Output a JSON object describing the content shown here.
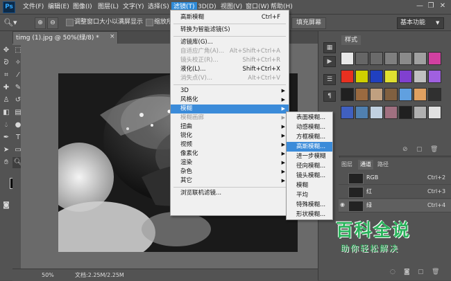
{
  "app": {
    "logo": "Ps"
  },
  "menubar": {
    "items": [
      "文件(F)",
      "编辑(E)",
      "图像(I)",
      "图层(L)",
      "文字(Y)",
      "选择(S)",
      "滤镜(T)",
      "3D(D)",
      "视图(V)",
      "窗口(W)",
      "帮助(H)"
    ],
    "window_buttons": [
      "—",
      "❐",
      "✕"
    ]
  },
  "options_bar": {
    "tool_icon": "zoom-icon",
    "checkbox1_label": "调整窗口大小以满屏显示",
    "checkbox2_label": "缩放所有",
    "fill_screen_button": "填充屏幕",
    "workspace_select": "基本功能"
  },
  "document": {
    "tab_label": "timg (1).jpg @ 50%(绿/8) *",
    "close": "×",
    "zoom": "50%",
    "doc_info": "文档:2.25M/2.25M",
    "image_desc": "rose-photo-channel-grayscale"
  },
  "filter_menu": {
    "items": [
      {
        "label": "高斯模糊",
        "shortcut": "Ctrl+F",
        "disabled": false
      },
      {
        "sep": true
      },
      {
        "label": "转换为智能滤镜(S)",
        "disabled": false
      },
      {
        "sep": true
      },
      {
        "label": "滤镜库(G)...",
        "disabled": false
      },
      {
        "label": "自适应广角(A)...",
        "shortcut": "Alt+Shift+Ctrl+A",
        "disabled": true
      },
      {
        "label": "镜头校正(R)...",
        "shortcut": "Shift+Ctrl+R",
        "disabled": true
      },
      {
        "label": "液化(L)...",
        "shortcut": "Shift+Ctrl+X",
        "disabled": false
      },
      {
        "label": "消失点(V)...",
        "shortcut": "Alt+Ctrl+V",
        "disabled": true
      },
      {
        "sep": true
      },
      {
        "label": "3D",
        "submenu": true,
        "disabled": false
      },
      {
        "label": "风格化",
        "submenu": true,
        "disabled": false
      },
      {
        "label": "模糊",
        "submenu": true,
        "disabled": false,
        "highlight": true
      },
      {
        "label": "模糊画廊",
        "submenu": true,
        "disabled": true
      },
      {
        "label": "扭曲",
        "submenu": true,
        "disabled": false
      },
      {
        "label": "锐化",
        "submenu": true,
        "disabled": false
      },
      {
        "label": "视频",
        "submenu": true,
        "disabled": false
      },
      {
        "label": "像素化",
        "submenu": true,
        "disabled": false
      },
      {
        "label": "渲染",
        "submenu": true,
        "disabled": false
      },
      {
        "label": "杂色",
        "submenu": true,
        "disabled": false
      },
      {
        "label": "其它",
        "submenu": true,
        "disabled": false
      },
      {
        "sep": true
      },
      {
        "label": "浏览联机滤镜...",
        "disabled": false
      }
    ]
  },
  "blur_submenu": {
    "items": [
      "表面模糊...",
      "动感模糊...",
      "方框模糊...",
      "高斯模糊...",
      "进一步模糊",
      "径向模糊...",
      "镜头模糊...",
      "模糊",
      "平均",
      "特殊模糊...",
      "形状模糊..."
    ],
    "highlighted_index": 3
  },
  "styles_panel": {
    "tab": "样式",
    "swatch_colors": [
      "#e8e8e8",
      "#666666",
      "#6a6a6a",
      "#7f7f7f",
      "#8a8a8a",
      "#a0a0a0",
      "#d040a0",
      "#e83020",
      "#d0d000",
      "#2040c0",
      "#e0e030",
      "#8040d0",
      "#c0c0c0",
      "#a060e0",
      "#202020",
      "#9a6a40",
      "#c0a080",
      "#806040",
      "#60a0e0",
      "#e0a060",
      "#303030",
      "#4060c0",
      "#5080b0",
      "#c0d0e0",
      "#a07080",
      "#202020",
      "#b0b0b0",
      "#e0e0e0"
    ]
  },
  "channels_panel": {
    "tabs": [
      "图层",
      "通道",
      "路径"
    ],
    "active_tab": 1,
    "channels": [
      {
        "name": "RGB",
        "shortcut": "Ctrl+2"
      },
      {
        "name": "红",
        "shortcut": "Ctrl+3"
      },
      {
        "name": "绿",
        "shortcut": "Ctrl+4"
      }
    ]
  },
  "watermark": {
    "title": "百科全说",
    "subtitle": "助你轻松解决"
  }
}
